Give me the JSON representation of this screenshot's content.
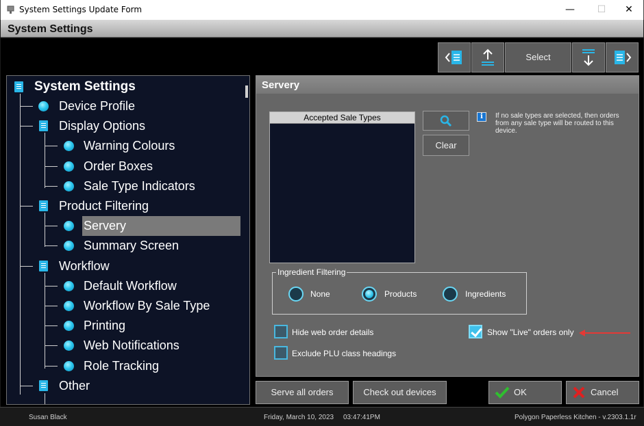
{
  "window": {
    "title": "System Settings Update Form",
    "min_glyph": "—",
    "max_glyph": "☐",
    "close_glyph": "✕"
  },
  "header": {
    "title": "System Settings"
  },
  "toolbar": {
    "select_label": "Select",
    "icons": [
      "prev-page-icon",
      "upload-icon",
      "download-icon",
      "next-page-icon"
    ]
  },
  "tree": {
    "root": "System Settings",
    "items": [
      {
        "label": "Device Profile",
        "level": 1,
        "icon": "dot"
      },
      {
        "label": "Display Options",
        "level": 1,
        "icon": "doc"
      },
      {
        "label": "Warning Colours",
        "level": 2,
        "icon": "dot"
      },
      {
        "label": "Order Boxes",
        "level": 2,
        "icon": "dot"
      },
      {
        "label": "Sale Type Indicators",
        "level": 2,
        "icon": "dot"
      },
      {
        "label": "Product Filtering",
        "level": 1,
        "icon": "doc"
      },
      {
        "label": "Servery",
        "level": 2,
        "icon": "dot",
        "selected": true
      },
      {
        "label": "Summary Screen",
        "level": 2,
        "icon": "dot"
      },
      {
        "label": "Workflow",
        "level": 1,
        "icon": "doc"
      },
      {
        "label": "Default Workflow",
        "level": 2,
        "icon": "dot"
      },
      {
        "label": "Workflow By Sale Type",
        "level": 2,
        "icon": "dot"
      },
      {
        "label": "Printing",
        "level": 2,
        "icon": "dot"
      },
      {
        "label": "Web Notifications",
        "level": 2,
        "icon": "dot"
      },
      {
        "label": "Role Tracking",
        "level": 2,
        "icon": "dot"
      },
      {
        "label": "Other",
        "level": 1,
        "icon": "doc"
      }
    ]
  },
  "panel": {
    "title": "Servery",
    "sale_types_header": "Accepted Sale Types",
    "clear_label": "Clear",
    "info_text": "If no sale types are selected, then orders from any sale type will be routed to this device.",
    "ingredient_filtering": {
      "label": "Ingredient Filtering",
      "options": [
        "None",
        "Products",
        "Ingredients"
      ],
      "selected": "Products"
    },
    "checkboxes": {
      "hide_web": {
        "label": "Hide web order details",
        "checked": false
      },
      "exclude_plu": {
        "label": "Exclude PLU class headings",
        "checked": false
      },
      "show_live": {
        "label": "Show \"Live\" orders only",
        "checked": true
      }
    }
  },
  "buttons": {
    "serve_all": "Serve all orders",
    "check_out": "Check out devices",
    "ok": "OK",
    "cancel": "Cancel"
  },
  "status": {
    "user": "Susan Black",
    "date": "Friday, March 10, 2023",
    "time": "03:47:41PM",
    "product": "Polygon Paperless Kitchen - v.2303.1.1r"
  },
  "colors": {
    "accent": "#29b6e8",
    "arrow": "#e53935",
    "ok_check": "#2fbf2f",
    "cancel_x": "#e02020"
  }
}
